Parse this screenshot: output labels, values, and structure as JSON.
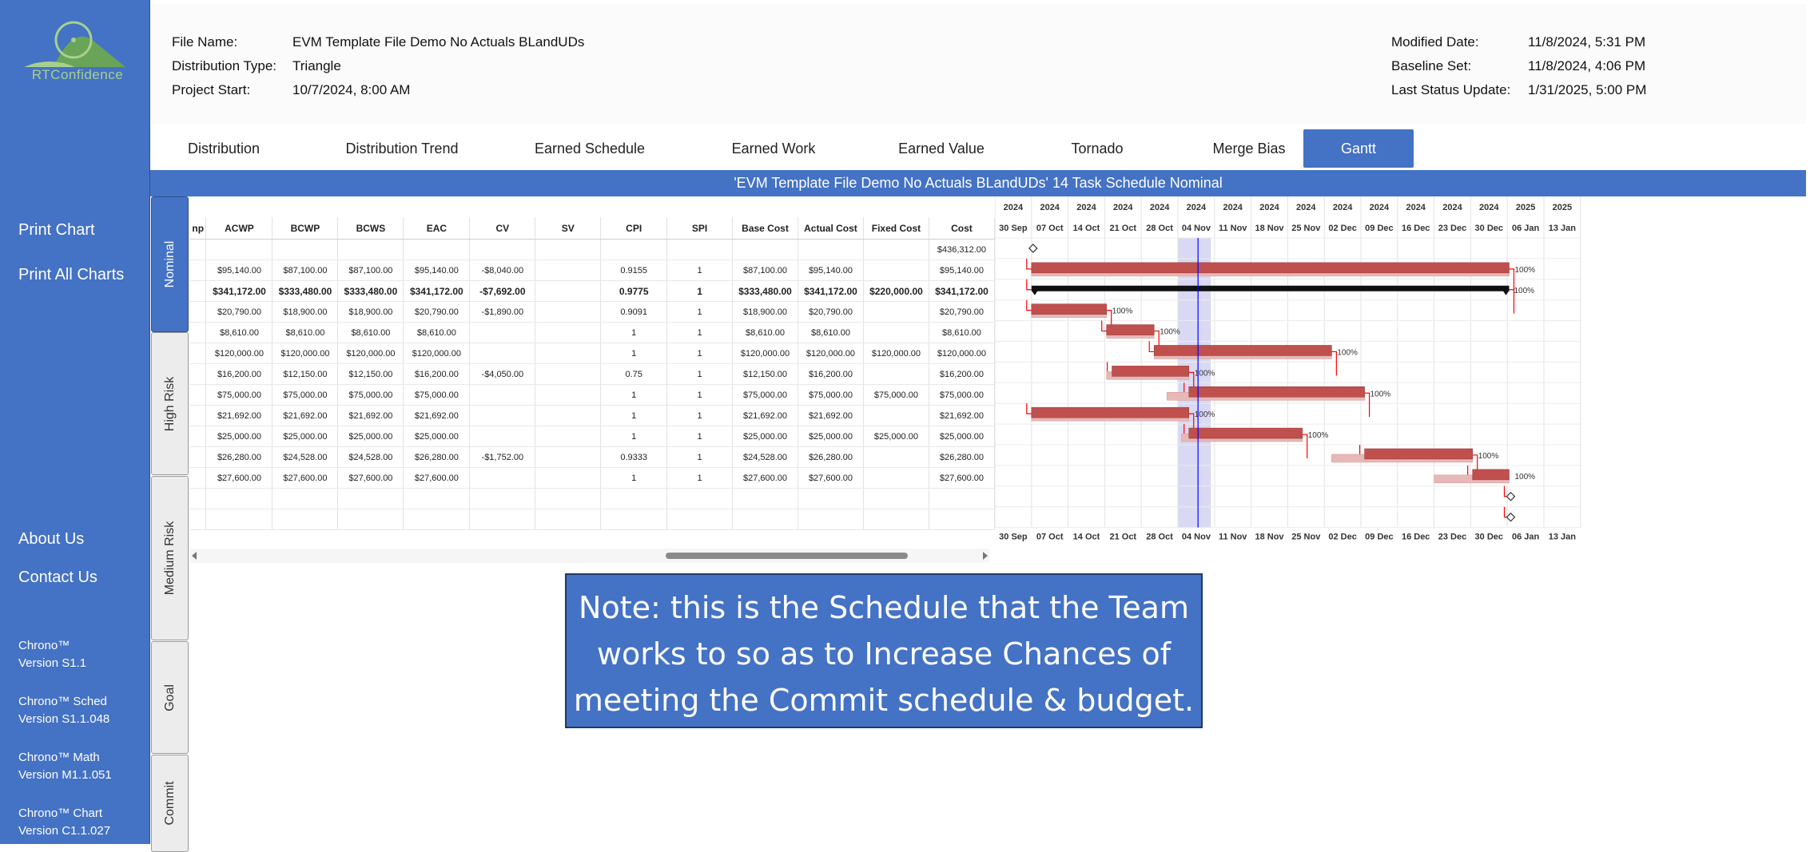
{
  "sidebar": {
    "logo_text": "RTConfidence",
    "links": [
      "Print Chart",
      "Print All Charts",
      "About Us",
      "Contact Us"
    ],
    "versions": [
      {
        "name": "Chrono™",
        "version": "Version S1.1"
      },
      {
        "name": "Chrono™ Sched",
        "version": "Version S1.1.048"
      },
      {
        "name": "Chrono™ Math",
        "version": "Version M1.1.051"
      },
      {
        "name": "Chrono™ Chart",
        "version": "Version C1.1.027"
      }
    ]
  },
  "header": {
    "file_name_label": "File Name:",
    "file_name": "EVM Template File Demo No Actuals BLandUDs",
    "dist_type_label": "Distribution Type:",
    "dist_type": "Triangle",
    "project_start_label": "Project Start:",
    "project_start": "10/7/2024, 8:00 AM",
    "modified_label": "Modified Date:",
    "modified": "11/8/2024, 5:31 PM",
    "baseline_label": "Baseline Set:",
    "baseline": "11/8/2024, 4:06 PM",
    "status_label": "Last Status Update:",
    "status": "1/31/2025, 5:00 PM"
  },
  "tabs": [
    "Distribution",
    "Distribution Trend",
    "Earned Schedule",
    "Earned Work",
    "Earned Value",
    "Tornado",
    "Merge Bias",
    "Gantt"
  ],
  "active_tab": "Gantt",
  "banner": "'EVM Template File Demo No Actuals BLandUDs' 14 Task Schedule Nominal",
  "side_tabs": [
    "Nominal",
    "High Risk",
    "Medium Risk",
    "Goal",
    "Commit"
  ],
  "table": {
    "columns": [
      "np",
      "ACWP",
      "BCWP",
      "BCWS",
      "EAC",
      "CV",
      "SV",
      "CPI",
      "SPI",
      "Base Cost",
      "Actual Cost",
      "Fixed Cost",
      "Cost"
    ],
    "rows": [
      [
        "",
        "",
        "",
        "",
        "",
        "",
        "",
        "",
        "",
        "",
        "",
        "",
        "$436,312.00"
      ],
      [
        "",
        "$95,140.00",
        "$87,100.00",
        "$87,100.00",
        "$95,140.00",
        "-$8,040.00",
        "",
        "0.9155",
        "1",
        "$87,100.00",
        "$95,140.00",
        "",
        "$95,140.00"
      ],
      [
        "",
        "$341,172.00",
        "$333,480.00",
        "$333,480.00",
        "$341,172.00",
        "-$7,692.00",
        "",
        "0.9775",
        "1",
        "$333,480.00",
        "$341,172.00",
        "$220,000.00",
        "$341,172.00"
      ],
      [
        "",
        "$20,790.00",
        "$18,900.00",
        "$18,900.00",
        "$20,790.00",
        "-$1,890.00",
        "",
        "0.9091",
        "1",
        "$18,900.00",
        "$20,790.00",
        "",
        "$20,790.00"
      ],
      [
        "",
        "$8,610.00",
        "$8,610.00",
        "$8,610.00",
        "$8,610.00",
        "",
        "",
        "1",
        "1",
        "$8,610.00",
        "$8,610.00",
        "",
        "$8,610.00"
      ],
      [
        "",
        "$120,000.00",
        "$120,000.00",
        "$120,000.00",
        "$120,000.00",
        "",
        "",
        "1",
        "1",
        "$120,000.00",
        "$120,000.00",
        "$120,000.00",
        "$120,000.00"
      ],
      [
        "",
        "$16,200.00",
        "$12,150.00",
        "$12,150.00",
        "$16,200.00",
        "-$4,050.00",
        "",
        "0.75",
        "1",
        "$12,150.00",
        "$16,200.00",
        "",
        "$16,200.00"
      ],
      [
        "",
        "$75,000.00",
        "$75,000.00",
        "$75,000.00",
        "$75,000.00",
        "",
        "",
        "1",
        "1",
        "$75,000.00",
        "$75,000.00",
        "$75,000.00",
        "$75,000.00"
      ],
      [
        "",
        "$21,692.00",
        "$21,692.00",
        "$21,692.00",
        "$21,692.00",
        "",
        "",
        "1",
        "1",
        "$21,692.00",
        "$21,692.00",
        "",
        "$21,692.00"
      ],
      [
        "",
        "$25,000.00",
        "$25,000.00",
        "$25,000.00",
        "$25,000.00",
        "",
        "",
        "1",
        "1",
        "$25,000.00",
        "$25,000.00",
        "$25,000.00",
        "$25,000.00"
      ],
      [
        "",
        "$26,280.00",
        "$24,528.00",
        "$24,528.00",
        "$26,280.00",
        "-$1,752.00",
        "",
        "0.9333",
        "1",
        "$24,528.00",
        "$26,280.00",
        "",
        "$26,280.00"
      ],
      [
        "",
        "$27,600.00",
        "$27,600.00",
        "$27,600.00",
        "$27,600.00",
        "",
        "",
        "1",
        "1",
        "$27,600.00",
        "$27,600.00",
        "",
        "$27,600.00"
      ],
      [
        "",
        "",
        "",
        "",
        "",
        "",
        "",
        "",
        "",
        "",
        "",
        "",
        ""
      ],
      [
        "",
        "",
        "",
        "",
        "",
        "",
        "",
        "",
        "",
        "",
        "",
        "",
        ""
      ]
    ],
    "bold_row": 2
  },
  "gantt": {
    "years": [
      "2024",
      "2024",
      "2024",
      "2024",
      "2024",
      "2024",
      "2024",
      "2024",
      "2024",
      "2024",
      "2024",
      "2024",
      "2024",
      "2024",
      "2025",
      "2025"
    ],
    "weeks": [
      "30 Sep",
      "07 Oct",
      "14 Oct",
      "21 Oct",
      "28 Oct",
      "04 Nov",
      "11 Nov",
      "18 Nov",
      "25 Nov",
      "02 Dec",
      "09 Dec",
      "16 Dec",
      "23 Dec",
      "30 Dec",
      "06 Jan",
      "13 Jan"
    ],
    "tasks": [
      {
        "type": "milestone",
        "start": 1.0
      },
      {
        "type": "bar",
        "start": 1.0,
        "end": 14.05,
        "baseline_start": 1.0,
        "baseline_end": 14.05,
        "pct": "100%"
      },
      {
        "type": "summary",
        "start": 1.0,
        "end": 14.05,
        "pct": "100%"
      },
      {
        "type": "bar",
        "start": 1.0,
        "end": 3.05,
        "baseline_start": 1.0,
        "baseline_end": 3.05,
        "pct": "100%"
      },
      {
        "type": "bar",
        "start": 3.05,
        "end": 4.35,
        "baseline_start": 3.05,
        "baseline_end": 4.35,
        "pct": "100%"
      },
      {
        "type": "bar",
        "start": 4.35,
        "end": 9.2,
        "baseline_start": 4.35,
        "baseline_end": 9.2,
        "pct": "100%"
      },
      {
        "type": "bar",
        "start": 3.2,
        "end": 5.3,
        "baseline_start": 3.05,
        "baseline_end": 5.3,
        "pct": "100%"
      },
      {
        "type": "bar",
        "start": 5.3,
        "end": 10.1,
        "baseline_start": 4.7,
        "baseline_end": 10.1,
        "pct": "100%"
      },
      {
        "type": "bar",
        "start": 1.0,
        "end": 5.3,
        "baseline_start": 1.0,
        "baseline_end": 5.3,
        "pct": "100%"
      },
      {
        "type": "bar",
        "start": 5.3,
        "end": 8.4,
        "baseline_start": 5.1,
        "baseline_end": 8.4,
        "pct": "100%"
      },
      {
        "type": "bar",
        "start": 10.1,
        "end": 13.05,
        "baseline_start": 9.2,
        "baseline_end": 13.05,
        "pct": "100%"
      },
      {
        "type": "bar",
        "start": 13.05,
        "end": 14.05,
        "baseline_start": 12.0,
        "baseline_end": 14.05,
        "pct": "100%"
      },
      {
        "type": "milestone",
        "start": 14.05
      },
      {
        "type": "milestone",
        "start": 14.05
      }
    ],
    "status_line": 5.55,
    "status_band": [
      5.0,
      5.9
    ],
    "colors": {
      "bar": "#c0504d",
      "baseline": "#e6b8b7",
      "summary": "#111111",
      "link": "#ff0000",
      "status": "#0000ff",
      "band": "#d9d9f3"
    }
  },
  "note": "Note: this is the Schedule that the Team works to so as to Increase Chances of meeting the Commit schedule & budget."
}
